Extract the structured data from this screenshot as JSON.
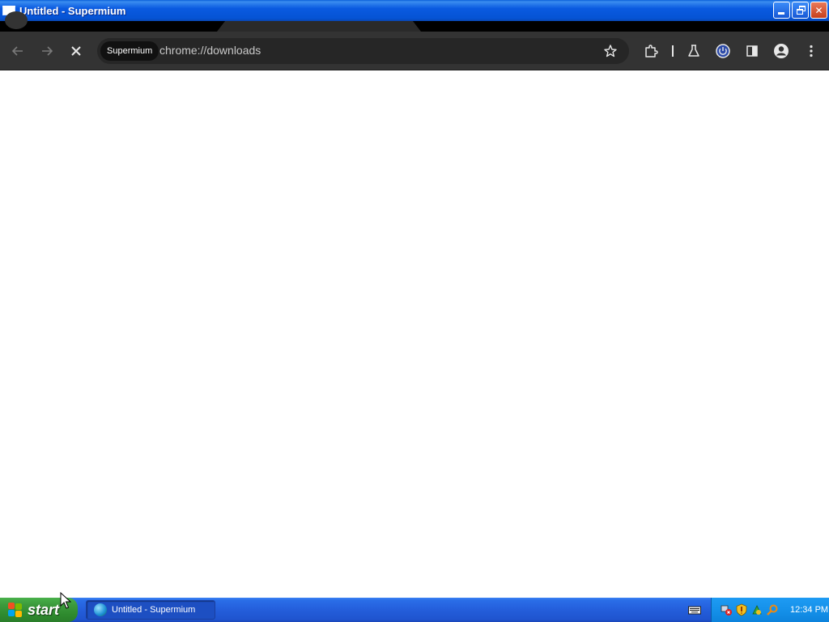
{
  "window": {
    "title": "Untitled - Supermium",
    "controls": [
      "minimize",
      "restore",
      "close"
    ]
  },
  "toolbar": {
    "back_icon": "arrow-left-icon",
    "forward_icon": "arrow-right-icon",
    "stop_icon": "close-icon",
    "omnibox": {
      "chip_label": "Supermium",
      "url": "chrome://downloads"
    },
    "actions": [
      "bookmark-star-icon",
      "extensions-icon",
      "labs-flask-icon",
      "sync-power-icon",
      "side-panel-icon",
      "profile-avatar-icon",
      "menu-kebab-icon"
    ]
  },
  "taskbar": {
    "start_label": "start",
    "tasks": [
      {
        "label": "Untitled - Supermium",
        "icon": "supermium-icon"
      }
    ],
    "clock": "12:34 PM"
  },
  "colors": {
    "titlebar": "#0a5ae0",
    "toolbar": "#333333",
    "omnibox": "#262626",
    "taskbar": "#245edb",
    "start": "#3c9a3c",
    "tray": "#1591ea"
  }
}
